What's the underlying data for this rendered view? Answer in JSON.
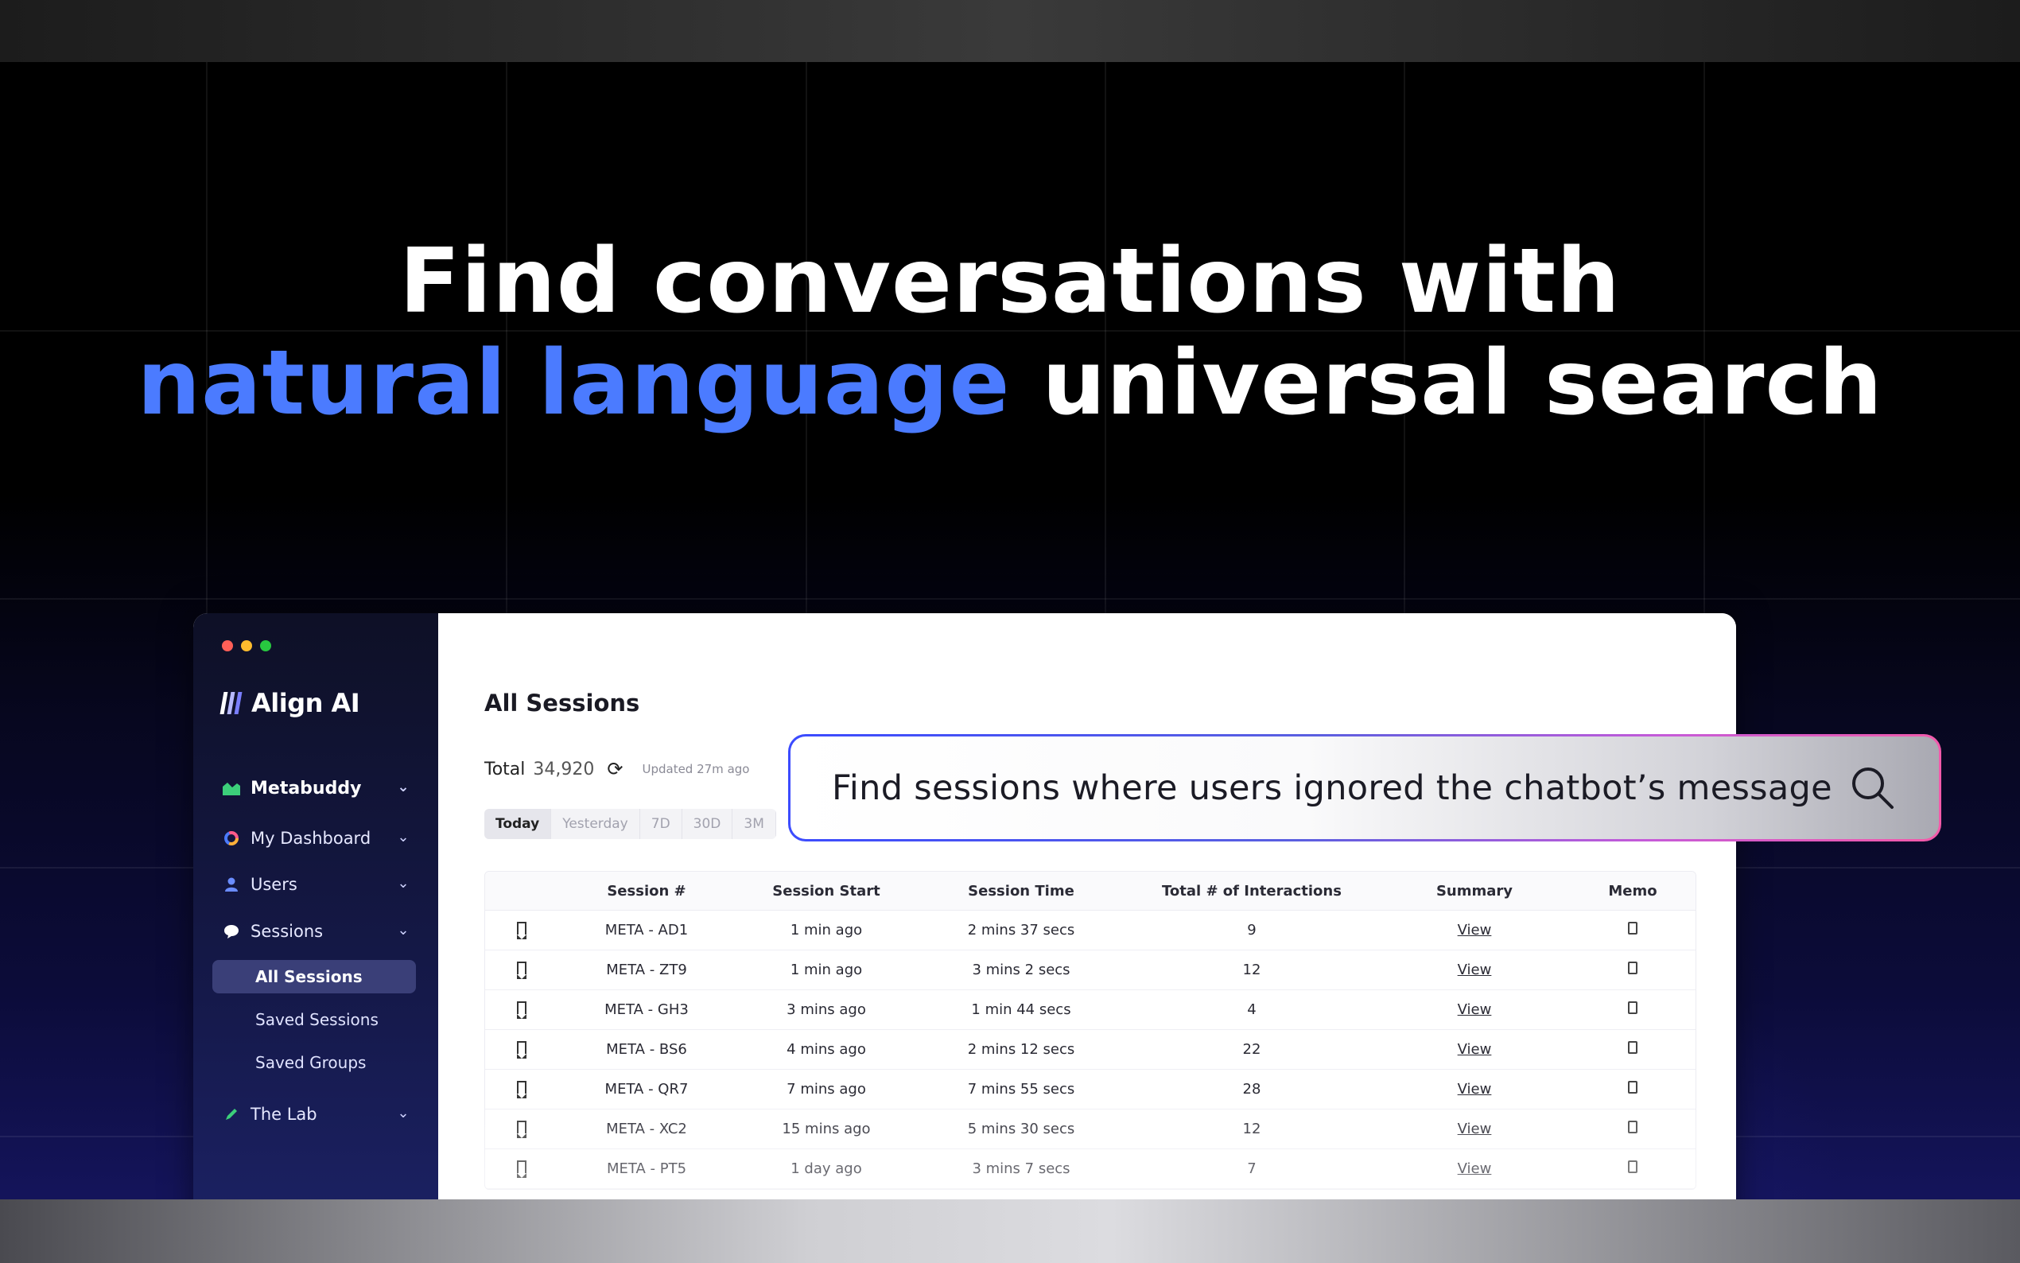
{
  "headline": {
    "line1": "Find conversations with",
    "accent": "natural language",
    "rest": " universal search"
  },
  "window": {
    "dot_colors": [
      "#ff5f57",
      "#febc2e",
      "#28c840"
    ]
  },
  "brand": {
    "name": "Align AI"
  },
  "sidebar": {
    "project": "Metabuddy",
    "items": [
      {
        "label": "My Dashboard",
        "icon": "dashboard-icon"
      },
      {
        "label": "Users",
        "icon": "user-icon"
      },
      {
        "label": "Sessions",
        "icon": "chat-bubble-icon"
      }
    ],
    "sub_items": [
      "All Sessions",
      "Saved Sessions",
      "Saved Groups"
    ],
    "lab": "The Lab"
  },
  "main": {
    "title": "All Sessions",
    "total_label": "Total",
    "total_value": "34,920",
    "updated": "Updated 27m ago",
    "ranges": [
      "Today",
      "Yesterday",
      "7D",
      "30D",
      "3M"
    ]
  },
  "search": {
    "query": "Find sessions where users ignored the chatbot’s message"
  },
  "table": {
    "headers": [
      "",
      "Session #",
      "Session Start",
      "Session Time",
      "Total # of Interactions",
      "Summary",
      "Memo"
    ],
    "rows": [
      [
        "META - AD1",
        "1 min ago",
        "2 mins 37 secs",
        "9",
        "View"
      ],
      [
        "META - ZT9",
        "1 min ago",
        "3 mins 2 secs",
        "12",
        "View"
      ],
      [
        "META - GH3",
        "3 mins ago",
        "1 min 44 secs",
        "4",
        "View"
      ],
      [
        "META - BS6",
        "4 mins ago",
        "2 mins 12 secs",
        "22",
        "View"
      ],
      [
        "META - QR7",
        "7 mins ago",
        "7 mins 55 secs",
        "28",
        "View"
      ],
      [
        "META - XC2",
        "15 mins ago",
        "5 mins 30 secs",
        "12",
        "View"
      ],
      [
        "META - PT5",
        "1 day ago",
        "3 mins 7 secs",
        "7",
        "View"
      ]
    ]
  }
}
